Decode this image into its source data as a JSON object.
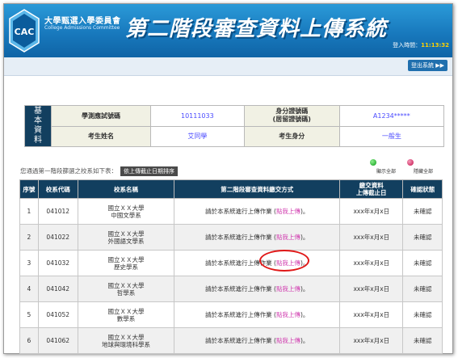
{
  "header": {
    "org_name_zh": "大學甄選入學委員會",
    "org_name_en": "College Admissions Committee",
    "system_title": "第二階段審查資料上傳系統",
    "login_time_label": "登入時間：",
    "login_time_value": "11:13:32",
    "logout_label": "登出系統"
  },
  "basic_info": {
    "section_label": "基本資料",
    "exam_no_label": "學測應試號碼",
    "exam_no_value": "10111033",
    "id_label_line1": "身分證號碼",
    "id_label_line2": "(居留證號碼)",
    "id_value": "A1234*****",
    "name_label": "考生姓名",
    "name_value": "艾同學",
    "identity_label": "考生身分",
    "identity_value": "一般生"
  },
  "notice": {
    "text": "您通過第一階段篩選之校系如下表：",
    "sort_button": "依上傳截止日期排序",
    "show_all": "顯示全部",
    "hide_all": "隱藏全部"
  },
  "table": {
    "headers": [
      "序號",
      "校系代碼",
      "校系名稱",
      "第二階段審查資料繳交方式",
      "繳交資料上傳截止日",
      "確認狀態"
    ],
    "deadline_header_line1": "繳交資料",
    "deadline_header_line2": "上傳截止日",
    "rows": [
      {
        "no": "1",
        "code": "041012",
        "school": "國立ＸＸ大學",
        "dept": "中國文學系",
        "method_pre": "請於本系統進行上傳作業 (",
        "method_link": "點我上傳",
        "method_post": ")。",
        "deadline": "xxx年x月x日",
        "status": "未確認"
      },
      {
        "no": "2",
        "code": "041022",
        "school": "國立ＸＸ大學",
        "dept": "外國語文學系",
        "method_pre": "請於本系統進行上傳作業 (",
        "method_link": "點我上傳",
        "method_post": ")。",
        "deadline": "xxx年x月x日",
        "status": "未確認"
      },
      {
        "no": "3",
        "code": "041032",
        "school": "國立ＸＸ大學",
        "dept": "歷史學系",
        "method_pre": "請於本系統進行上傳作業 (",
        "method_link": "點我上傳",
        "method_post": ")。",
        "deadline": "xxx年x月x日",
        "status": "未確認"
      },
      {
        "no": "4",
        "code": "041042",
        "school": "國立ＸＸ大學",
        "dept": "哲學系",
        "method_pre": "請於本系統進行上傳作業 (",
        "method_link": "點我上傳",
        "method_post": ")。",
        "deadline": "xxx年x月x日",
        "status": "未確認"
      },
      {
        "no": "5",
        "code": "041052",
        "school": "國立ＸＸ大學",
        "dept": "數學系",
        "method_pre": "請於本系統進行上傳作業 (",
        "method_link": "點我上傳",
        "method_post": ")。",
        "deadline": "xxx年x月x日",
        "status": "未確認"
      },
      {
        "no": "6",
        "code": "041062",
        "school": "國立ＸＸ大學",
        "dept": "地球與環境科學系",
        "method_pre": "請於本系統進行上傳作業 (",
        "method_link": "點我上傳",
        "method_post": ")。",
        "deadline": "xxx年x月x日",
        "status": "未確認"
      }
    ]
  },
  "colors": {
    "header_blue": "#1879bd",
    "table_header": "#123f5f",
    "upload_link": "#d13fb0",
    "status_link": "#2e3bd6",
    "highlight_circle": "#e01818"
  }
}
